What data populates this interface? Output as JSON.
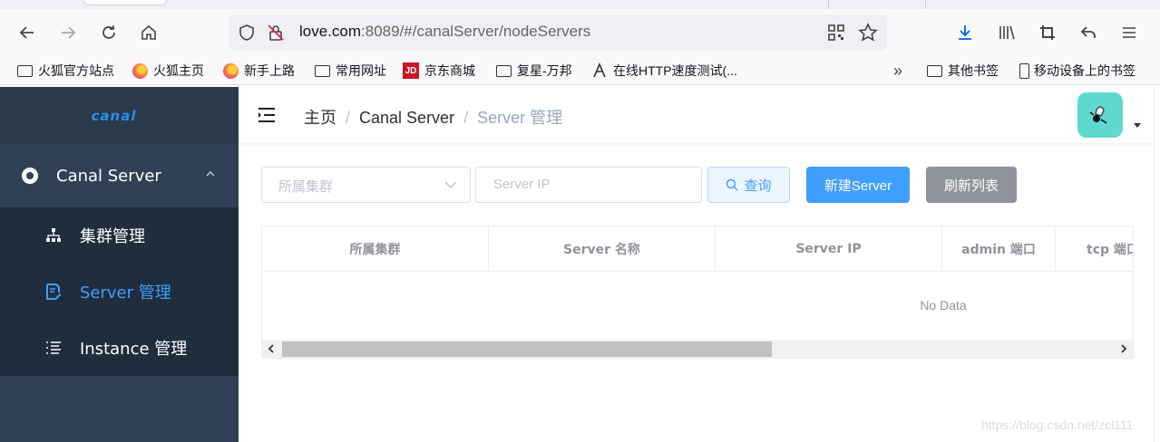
{
  "browser": {
    "url_host": "love.com",
    "url_rest": ":8089/#/canalServer/nodeServers",
    "bookmarks": [
      {
        "label": "火狐官方站点",
        "icon": "folder-icon"
      },
      {
        "label": "火狐主页",
        "icon": "firefox-icon"
      },
      {
        "label": "新手上路",
        "icon": "firefox-icon"
      },
      {
        "label": "常用网址",
        "icon": "folder-icon"
      },
      {
        "label": "京东商城",
        "icon": "jd-icon"
      },
      {
        "label": "复星-万邦",
        "icon": "folder-icon"
      },
      {
        "label": "在线HTTP速度测试(...",
        "icon": "speed-icon"
      },
      {
        "label": "其他书签",
        "icon": "folder-icon"
      },
      {
        "label": "移动设备上的书签",
        "icon": "mobile-icon"
      }
    ],
    "jd_icon_text": "JD"
  },
  "sidebar": {
    "logo": "canal",
    "group": {
      "label": "Canal Server"
    },
    "items": [
      {
        "label": "集群管理",
        "icon": "sitemap-icon",
        "active": false
      },
      {
        "label": "Server 管理",
        "icon": "document-edit-icon",
        "active": true
      },
      {
        "label": "Instance 管理",
        "icon": "list-icon",
        "active": false
      }
    ]
  },
  "header": {
    "breadcrumb": [
      "主页",
      "Canal Server",
      "Server 管理"
    ],
    "separator": "/"
  },
  "filters": {
    "cluster_placeholder": "所属集群",
    "ip_placeholder": "Server IP",
    "query_label": "查询",
    "new_label": "新建Server",
    "refresh_label": "刷新列表"
  },
  "table": {
    "columns": [
      "所属集群",
      "Server 名称",
      "Server IP",
      "admin 端口",
      "tcp 端口"
    ],
    "empty_text": "No Data"
  },
  "watermark": "https://blog.csdn.net/zcl111",
  "colors": {
    "sidebar_bg": "#304156",
    "submenu_bg": "#1f2d3d",
    "active": "#409eff",
    "primary": "#409eff",
    "info": "#909399"
  }
}
